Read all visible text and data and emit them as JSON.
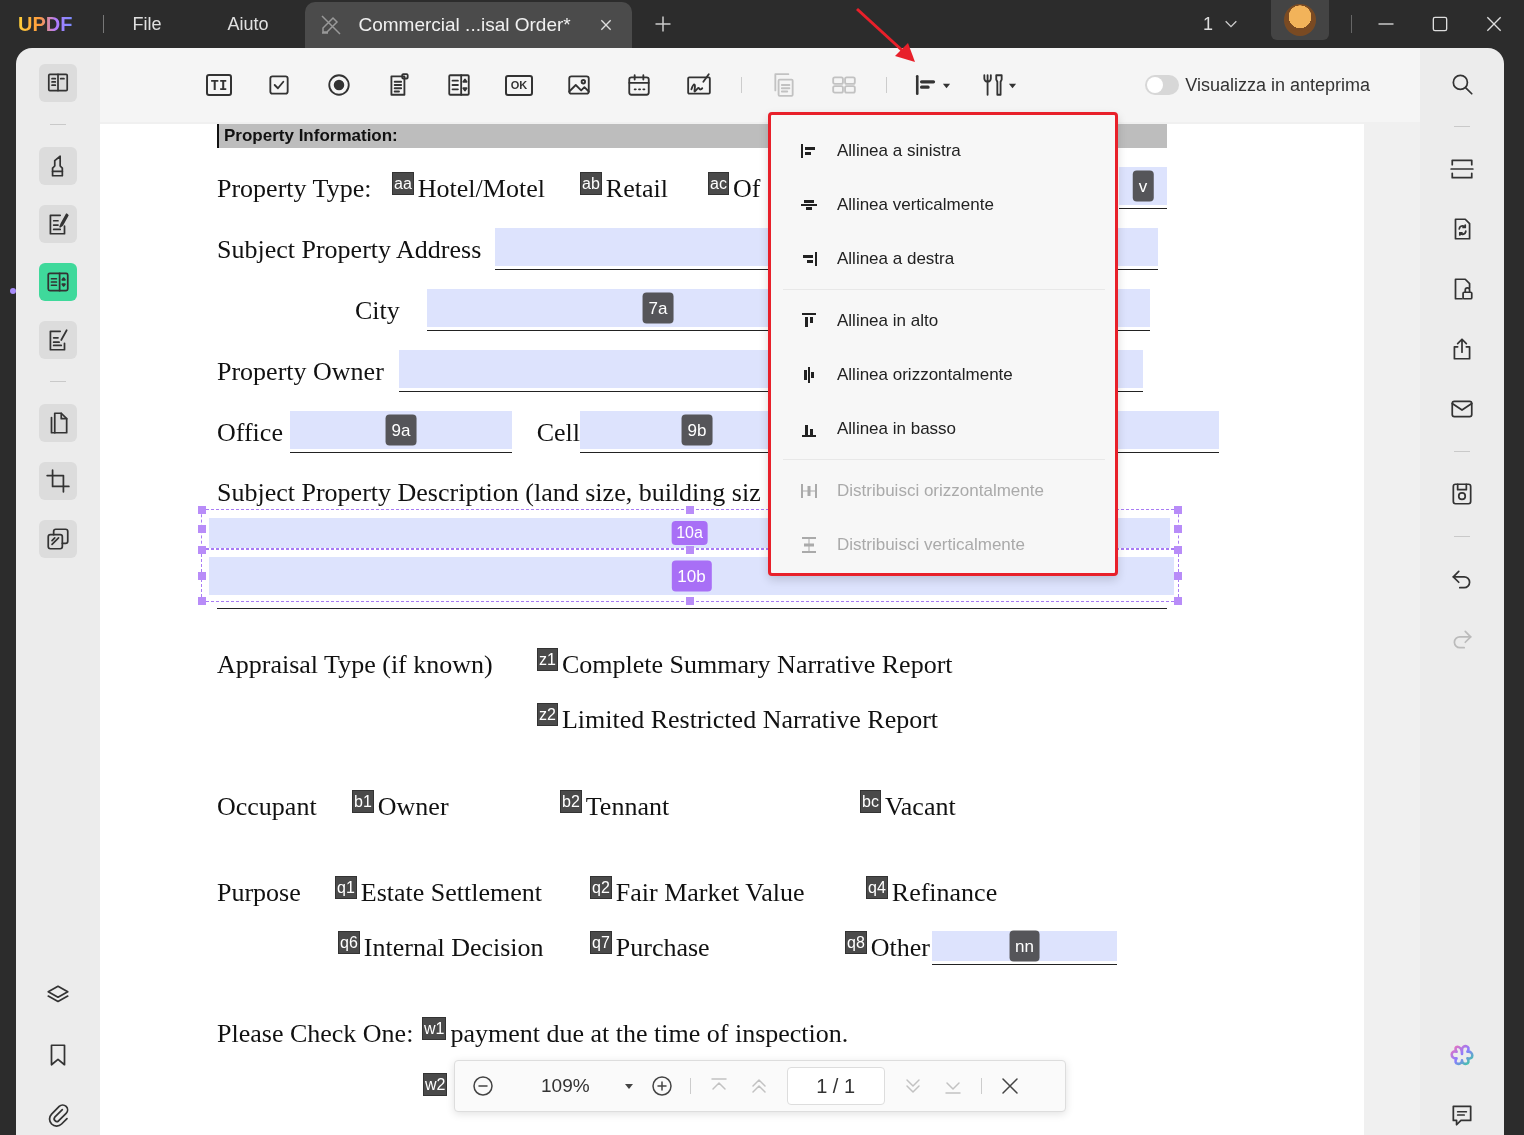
{
  "titlebar": {
    "logo": "UPDF",
    "menus": [
      "File",
      "Aiuto"
    ],
    "tab": {
      "title": "Commercial ...isal Order*"
    },
    "page_count": "1"
  },
  "left_sidebar": {
    "groups": [
      [
        {
          "kind": "reader",
          "selected": false
        }
      ],
      [
        {
          "kind": "comment",
          "selected": false
        },
        {
          "kind": "edit",
          "selected": false
        },
        {
          "kind": "form",
          "selected": true
        },
        {
          "kind": "sign",
          "selected": false
        }
      ],
      [
        {
          "kind": "organize",
          "selected": false
        },
        {
          "kind": "crop",
          "selected": false
        },
        {
          "kind": "watermark",
          "selected": false
        }
      ]
    ],
    "bottom": [
      {
        "kind": "layers",
        "selected": false
      },
      {
        "kind": "bookmark",
        "selected": false
      },
      {
        "kind": "attachment",
        "selected": false
      }
    ]
  },
  "toolbar": {
    "groups": [
      [
        {
          "kind": "text-field",
          "label": "TI",
          "disabled": false
        },
        {
          "kind": "checkbox",
          "disabled": false
        },
        {
          "kind": "radio",
          "disabled": false
        },
        {
          "kind": "listbox",
          "disabled": false
        },
        {
          "kind": "dropdown",
          "disabled": false
        },
        {
          "kind": "button",
          "label": "OK",
          "disabled": false
        },
        {
          "kind": "image",
          "disabled": false
        },
        {
          "kind": "date",
          "disabled": false
        },
        {
          "kind": "signature",
          "disabled": false
        }
      ],
      [
        {
          "kind": "duplicate",
          "disabled": true
        },
        {
          "kind": "layout",
          "disabled": true
        }
      ],
      [
        {
          "kind": "align",
          "disabled": false
        },
        {
          "kind": "tools",
          "disabled": false
        }
      ]
    ],
    "preview": {
      "label": "Visualizza in anteprima",
      "on": false
    }
  },
  "right_sidebar": {
    "groups": [
      [
        {
          "kind": "search",
          "disabled": false
        }
      ],
      [
        {
          "kind": "ocr",
          "disabled": false
        },
        {
          "kind": "convert",
          "disabled": false
        },
        {
          "kind": "protect",
          "disabled": false
        },
        {
          "kind": "share",
          "disabled": false
        },
        {
          "kind": "email",
          "disabled": false
        }
      ],
      [
        {
          "kind": "save",
          "disabled": false
        }
      ],
      [
        {
          "kind": "undo",
          "disabled": false
        },
        {
          "kind": "redo",
          "disabled": true
        }
      ]
    ],
    "bottom": [
      {
        "kind": "ai"
      },
      {
        "kind": "chat"
      }
    ]
  },
  "document": {
    "header": "Property Information:",
    "rows": [
      {
        "kind": "line",
        "items": [
          {
            "kind": "text",
            "text": "Property Type:"
          },
          {
            "kind": "check",
            "tag": "aa",
            "label": "Hotel/Motel"
          },
          {
            "kind": "check",
            "tag": "ab",
            "label": "Retail"
          },
          {
            "kind": "check",
            "tag": "ac",
            "label": "Of"
          },
          {
            "kind": "field",
            "tag": "v"
          }
        ]
      },
      {
        "kind": "line",
        "items": [
          {
            "kind": "text",
            "text": "Subject Property Address"
          },
          {
            "kind": "field"
          }
        ]
      },
      {
        "kind": "line",
        "items": [
          {
            "kind": "text",
            "text": "City"
          },
          {
            "kind": "field",
            "tag": "7a"
          }
        ]
      },
      {
        "kind": "line",
        "items": [
          {
            "kind": "text",
            "text": "Property Owner"
          },
          {
            "kind": "field"
          }
        ]
      },
      {
        "kind": "line",
        "items": [
          {
            "kind": "text",
            "text": "Office"
          },
          {
            "kind": "field",
            "tag": "9a"
          },
          {
            "kind": "text",
            "text": "Cell"
          },
          {
            "kind": "field",
            "tag": "9b"
          }
        ]
      },
      {
        "kind": "line",
        "items": [
          {
            "kind": "text",
            "text": "Subject Property Description (land size, building siz"
          }
        ]
      },
      {
        "kind": "fields",
        "items": [
          {
            "kind": "field",
            "tag": "10a",
            "selected": true
          },
          {
            "kind": "field",
            "tag": "10b",
            "selected": true
          }
        ]
      },
      {
        "kind": "line",
        "items": [
          {
            "kind": "text",
            "text": "Appraisal Type (if known)"
          },
          {
            "kind": "check",
            "tag": "z1",
            "label": "Complete Summary Narrative Report"
          }
        ]
      },
      {
        "kind": "line",
        "items": [
          {
            "kind": "check",
            "tag": "z2",
            "label": "Limited Restricted Narrative Report"
          }
        ]
      },
      {
        "kind": "line",
        "items": [
          {
            "kind": "text",
            "text": "Occupant"
          },
          {
            "kind": "check",
            "tag": "b1",
            "label": "Owner"
          },
          {
            "kind": "check",
            "tag": "b2",
            "label": "Tennant"
          },
          {
            "kind": "check",
            "tag": "bc",
            "label": "Vacant"
          }
        ]
      },
      {
        "kind": "line",
        "items": [
          {
            "kind": "text",
            "text": "Purpose"
          },
          {
            "kind": "check",
            "tag": "q1",
            "label": "Estate Settlement"
          },
          {
            "kind": "check",
            "tag": "q2",
            "label": "Fair Market Value"
          },
          {
            "kind": "check",
            "tag": "q4",
            "label": "Refinance"
          }
        ]
      },
      {
        "kind": "line",
        "items": [
          {
            "kind": "check",
            "tag": "q6",
            "label": "Internal Decision"
          },
          {
            "kind": "check",
            "tag": "q7",
            "label": "Purchase"
          },
          {
            "kind": "check",
            "tag": "q8",
            "label": "Other"
          },
          {
            "kind": "field",
            "tag": "nn"
          }
        ]
      },
      {
        "kind": "line",
        "items": [
          {
            "kind": "text",
            "text": "Please Check One:"
          },
          {
            "kind": "check",
            "tag": "w1",
            "label": "payment due at the time of inspection."
          }
        ]
      },
      {
        "kind": "line",
        "items": [
          {
            "kind": "check",
            "tag": "w2"
          }
        ]
      }
    ]
  },
  "align_menu": {
    "groups": [
      [
        {
          "kind": "left",
          "label": "Allinea a sinistra",
          "disabled": false
        },
        {
          "kind": "vcenter",
          "label": "Allinea verticalmente",
          "disabled": false
        },
        {
          "kind": "right",
          "label": "Allinea a destra",
          "disabled": false
        }
      ],
      [
        {
          "kind": "top",
          "label": "Allinea in alto",
          "disabled": false
        },
        {
          "kind": "hcenter",
          "label": "Allinea orizzontalmente",
          "disabled": false
        },
        {
          "kind": "bottom",
          "label": "Allinea in basso",
          "disabled": false
        }
      ],
      [
        {
          "kind": "dist-h",
          "label": "Distribuisci orizzontalmente",
          "disabled": true
        },
        {
          "kind": "dist-v",
          "label": "Distribuisci verticalmente",
          "disabled": true
        }
      ]
    ]
  },
  "zoom_bar": {
    "zoom": "109%",
    "page": "1 / 1",
    "nav": [
      {
        "kind": "first",
        "disabled": true
      },
      {
        "kind": "prev",
        "disabled": true
      },
      {
        "kind": "next",
        "disabled": true
      },
      {
        "kind": "last",
        "disabled": true
      }
    ]
  }
}
